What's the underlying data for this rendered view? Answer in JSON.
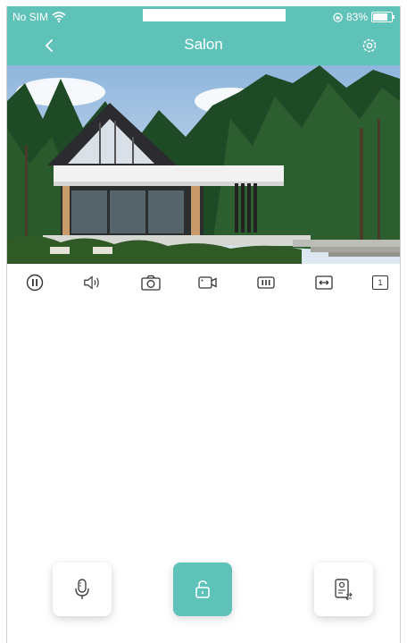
{
  "status_bar": {
    "carrier": "No SIM",
    "battery": "83%"
  },
  "header": {
    "title": "Salon"
  },
  "controls": {
    "pause": "pause-icon",
    "audio": "speaker-icon",
    "snapshot": "camera-icon",
    "record": "video-icon",
    "quality": "quality-icon",
    "fit": "resize-icon",
    "channel": "1"
  },
  "actions": {
    "talk": "microphone-icon",
    "unlock": "unlock-icon",
    "switch_device": "intercom-switch-icon"
  },
  "colors": {
    "accent": "#5fc2b8"
  }
}
